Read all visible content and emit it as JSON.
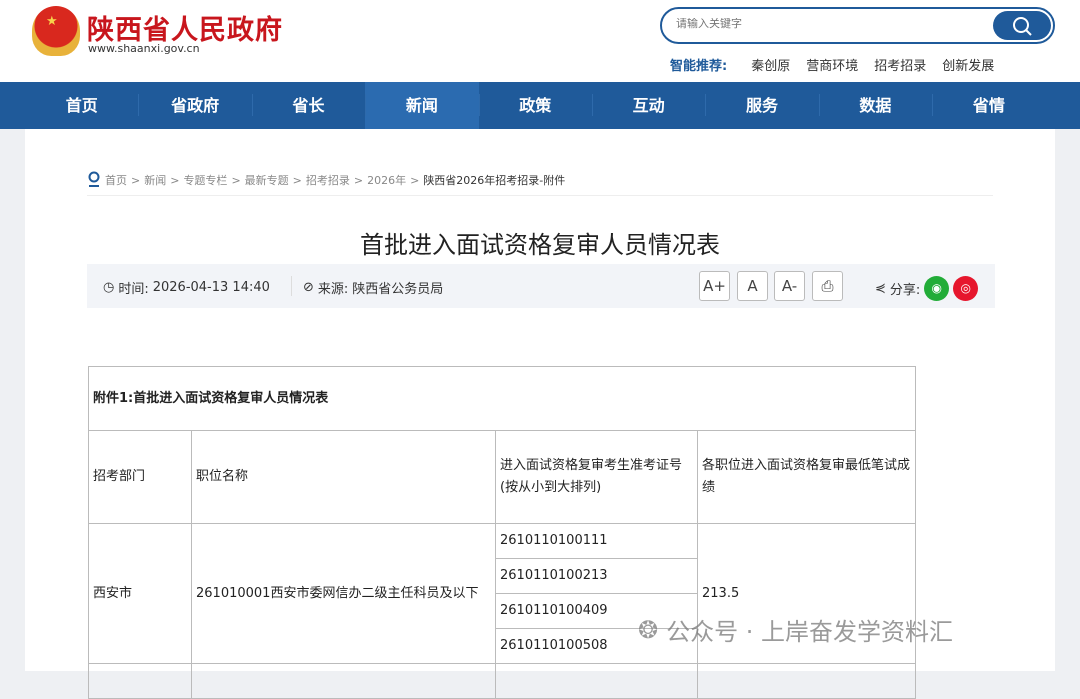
{
  "header": {
    "site_title": "陕西省人民政府",
    "site_url": "www.shaanxi.gov.cn",
    "search_placeholder": "请输入关键字",
    "rec_label": "智能推荐:",
    "rec_keywords": [
      "秦创原",
      "营商环境",
      "招考招录",
      "创新发展"
    ]
  },
  "nav": [
    "首页",
    "省政府",
    "省长",
    "新闻",
    "政策",
    "互动",
    "服务",
    "数据",
    "省情"
  ],
  "breadcrumb": [
    "首页",
    "新闻",
    "专题专栏",
    "最新专题",
    "招考招录",
    "2026年",
    "陕西省2026年招考招录-附件"
  ],
  "article": {
    "title": "首批进入面试资格复审人员情况表",
    "time_label": "时间:",
    "time": "2026-04-13 14:40",
    "source_label": "来源:",
    "source": "陕西省公务员局",
    "font_buttons": [
      "A+",
      "A",
      "A-"
    ],
    "share_label": "分享:"
  },
  "table": {
    "caption": "附件1:首批进入面试资格复审人员情况表",
    "headers": [
      "招考部门",
      "职位名称",
      "进入面试资格复审考生准考证号(按从小到大排列)",
      "各职位进入面试资格复审最低笔试成绩"
    ],
    "rows": [
      {
        "dept": "西安市",
        "position": "261010001西安市委网信办二级主任科员及以下",
        "ids": [
          "2610110100111",
          "2610110100213",
          "2610110100409",
          "2610110100508"
        ],
        "min_score": "213.5"
      }
    ]
  },
  "watermark": "公众号 · 上岸奋发学资料汇"
}
